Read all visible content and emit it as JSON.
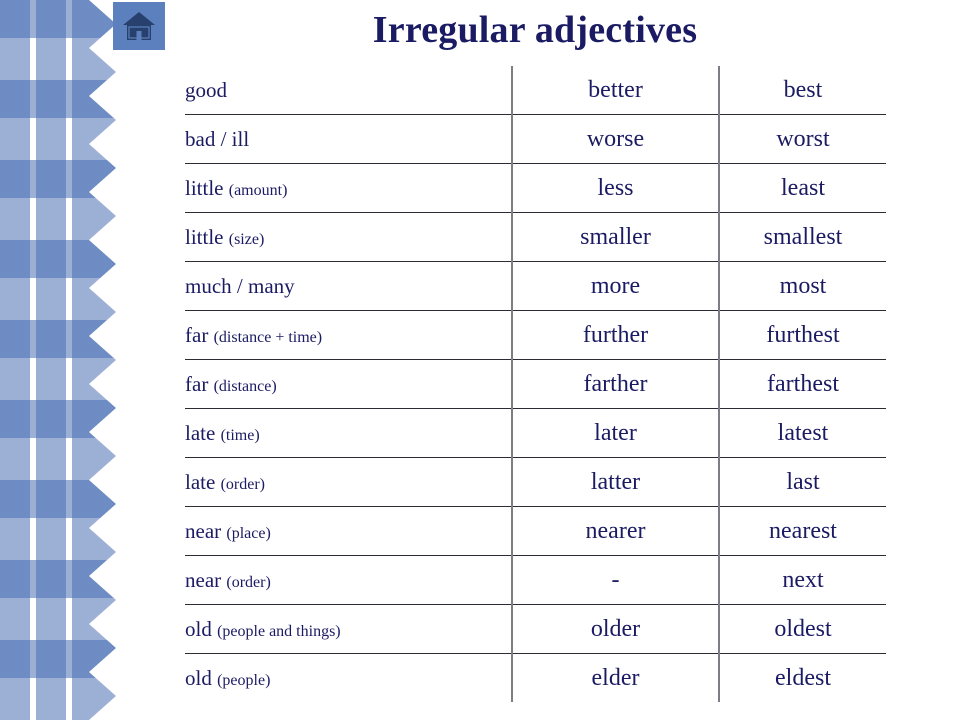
{
  "page": {
    "title": "Irregular adjectives"
  },
  "home_button": {
    "icon": "home-icon"
  },
  "table": {
    "rows": [
      {
        "base": "good",
        "qualifier": "",
        "comparative": "better",
        "superlative": "best"
      },
      {
        "base": "bad / ill",
        "qualifier": "",
        "comparative": "worse",
        "superlative": "worst"
      },
      {
        "base": "little",
        "qualifier": "(amount)",
        "comparative": "less",
        "superlative": "least"
      },
      {
        "base": "little",
        "qualifier": "(size)",
        "comparative": "smaller",
        "superlative": "smallest"
      },
      {
        "base": "much / many",
        "qualifier": "",
        "comparative": "more",
        "superlative": "most"
      },
      {
        "base": "far",
        "qualifier": "(distance + time)",
        "comparative": "further",
        "superlative": "furthest"
      },
      {
        "base": "far",
        "qualifier": "(distance)",
        "comparative": "farther",
        "superlative": "farthest"
      },
      {
        "base": "late",
        "qualifier": "(time)",
        "comparative": "later",
        "superlative": "latest"
      },
      {
        "base": "late",
        "qualifier": "(order)",
        "comparative": "latter",
        "superlative": "last"
      },
      {
        "base": "near",
        "qualifier": "(place)",
        "comparative": "nearer",
        "superlative": "nearest"
      },
      {
        "base": "near",
        "qualifier": "(order)",
        "comparative": "-",
        "superlative": "next"
      },
      {
        "base": "old",
        "qualifier": "(people and things)",
        "comparative": "older",
        "superlative": "oldest"
      },
      {
        "base": "old",
        "qualifier": "(people)",
        "comparative": "elder",
        "superlative": "eldest"
      }
    ]
  },
  "colors": {
    "text_navy": "#1b1b63",
    "gingham_blue": "#4a6fb5",
    "gingham_light_blue": "#8fa9d8",
    "home_button_bg": "#5b80bd",
    "rule": "#2b2b33"
  }
}
